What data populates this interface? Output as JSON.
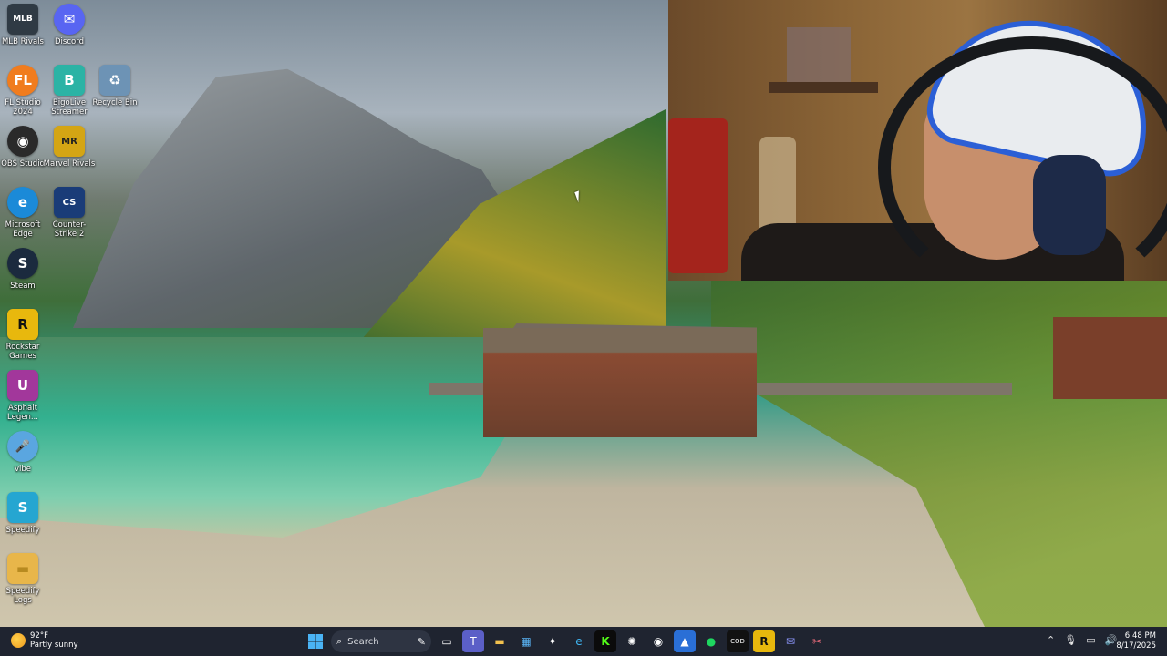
{
  "desktop_icons": [
    {
      "label": "MLB Rivals",
      "glyph": "MLB",
      "color": "#2f3a44"
    },
    {
      "label": "Discord",
      "glyph": "✉",
      "color": "#5865f2"
    },
    {
      "label": "FL Studio 2024",
      "glyph": "FL",
      "color": "#f07c1e"
    },
    {
      "label": "BigoLive Streamer",
      "glyph": "B",
      "color": "#2bb3a5"
    },
    {
      "label": "Recycle Bin",
      "glyph": "♻",
      "color": "#6d93b5"
    },
    {
      "label": "OBS Studio",
      "glyph": "◉",
      "color": "#2a2a2a"
    },
    {
      "label": "Marvel Rivals",
      "glyph": "MR",
      "color": "#d4a514"
    },
    {
      "label": "Microsoft Edge",
      "glyph": "e",
      "color": "#1b8ad8"
    },
    {
      "label": "Counter-Strike 2",
      "glyph": "CS",
      "color": "#1a3c78"
    },
    {
      "label": "Steam",
      "glyph": "S",
      "color": "#1b2a3e"
    },
    {
      "label": "Rockstar Games",
      "glyph": "R",
      "color": "#e8b80d"
    },
    {
      "label": "Asphalt Legen...",
      "glyph": "U",
      "color": "#a2379b"
    },
    {
      "label": "vibe",
      "glyph": "🎤",
      "color": "#5aa6e0"
    },
    {
      "label": "Speedify",
      "glyph": "S",
      "color": "#25a6d1"
    },
    {
      "label": "Speedify Logs",
      "glyph": "▬",
      "color": "#e8b64a"
    }
  ],
  "taskbar": {
    "weather": {
      "temp": "92°F",
      "condition": "Partly sunny"
    },
    "search_placeholder": "Search",
    "apps": [
      "task-view",
      "teams",
      "file-explorer",
      "store",
      "pin-app",
      "edge",
      "kick",
      "chatgpt",
      "obs-rec",
      "streamlabs",
      "spotify",
      "call-of-duty",
      "rockstar",
      "discord",
      "snipping"
    ],
    "clock": {
      "time": "6:48 PM",
      "date": "8/17/2025"
    }
  },
  "colors": {
    "taskbar": "#1f2430",
    "accent": "#2b7de9"
  }
}
